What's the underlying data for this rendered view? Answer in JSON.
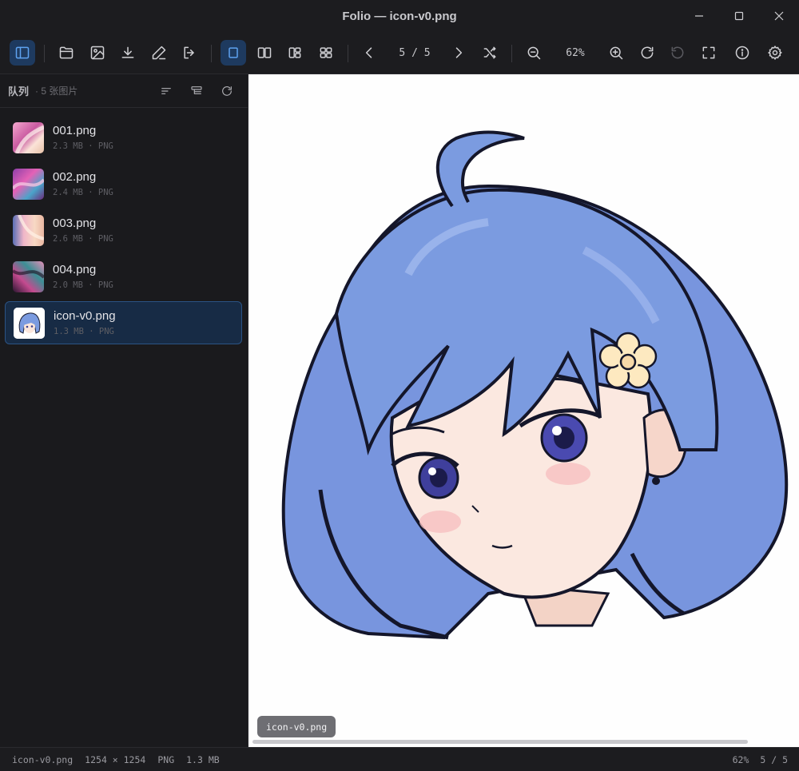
{
  "window": {
    "title": "Folio — icon-v0.png"
  },
  "toolbar": {
    "buttons": [
      {
        "icon": "sidebar-toggle-icon",
        "active": true
      },
      {
        "icon": "folder-open-icon"
      },
      {
        "icon": "image-icon"
      },
      {
        "icon": "download-icon"
      },
      {
        "icon": "pencil-icon"
      },
      {
        "icon": "export-icon"
      },
      {
        "icon": "single-view-icon",
        "active": true
      },
      {
        "icon": "two-up-view-icon"
      },
      {
        "icon": "split-view-icon"
      },
      {
        "icon": "grid-view-icon"
      },
      {
        "icon": "prev-arrow-icon"
      },
      {
        "icon": "next-arrow-icon"
      },
      {
        "icon": "shuffle-icon"
      },
      {
        "icon": "zoom-out-icon"
      },
      {
        "icon": "zoom-in-icon"
      },
      {
        "icon": "rotate-cw-icon"
      },
      {
        "icon": "rotate-ccw-icon",
        "disabled": true
      },
      {
        "icon": "fullscreen-icon"
      },
      {
        "icon": "info-icon"
      },
      {
        "icon": "settings-gear-icon"
      }
    ],
    "pager": "5 / 5",
    "zoom": "62%"
  },
  "sidebar": {
    "title": "队列",
    "count": "· 5 张图片",
    "items": [
      {
        "name": "001.png",
        "info": "2.3 MB · PNG",
        "selected": false
      },
      {
        "name": "002.png",
        "info": "2.4 MB · PNG",
        "selected": false
      },
      {
        "name": "003.png",
        "info": "2.6 MB · PNG",
        "selected": false
      },
      {
        "name": "004.png",
        "info": "2.0 MB · PNG",
        "selected": false
      },
      {
        "name": "icon-v0.png",
        "info": "1.3 MB · PNG",
        "selected": true
      }
    ]
  },
  "viewer": {
    "overlay_label": "icon-v0.png"
  },
  "status": {
    "file": "icon-v0.png",
    "dims": "1254 × 1254",
    "format": "PNG",
    "size": "1.3 MB",
    "zoom": "62%",
    "pager": "5 / 5"
  },
  "colors": {
    "accent": "#5ea2f0",
    "selection_bg": "#172b45",
    "hair": "#7b9be0"
  }
}
